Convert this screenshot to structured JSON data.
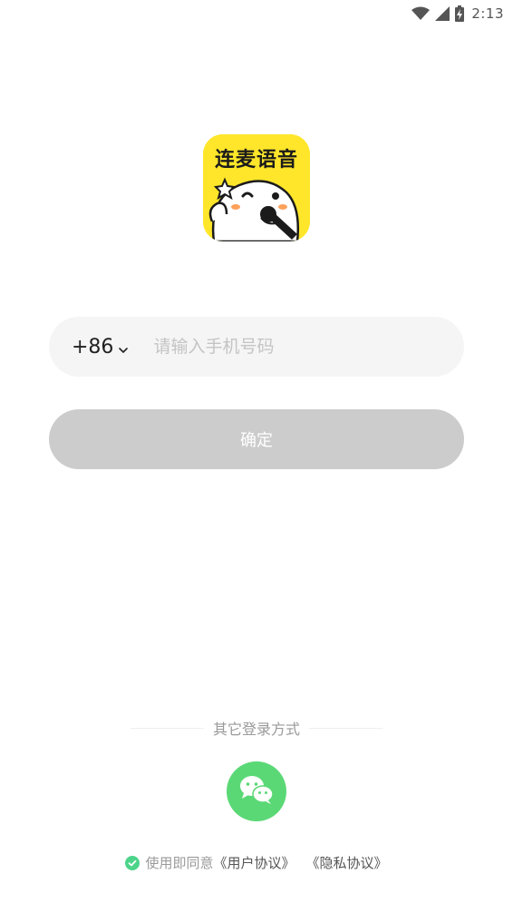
{
  "status_bar": {
    "time": "2:13",
    "icons": [
      "wifi-icon",
      "signal-icon",
      "battery-charging-icon"
    ]
  },
  "logo": {
    "text": "连麦语音",
    "icon": "mascot-with-microphone"
  },
  "phone": {
    "country_code": "+86",
    "placeholder": "请输入手机号码",
    "value": ""
  },
  "confirm": {
    "label": "确定"
  },
  "other_login": {
    "label": "其它登录方式",
    "wechat_icon": "wechat-icon"
  },
  "agreement": {
    "prefix": "使用即同意",
    "user_agreement": "《用户协议》",
    "privacy_policy": "《隐私协议》"
  },
  "colors": {
    "brand_yellow": "#ffe62a",
    "wechat_green": "#5bd876",
    "check_green": "#4cd48a",
    "button_disabled": "#cccccc",
    "input_bg": "#f5f5f5"
  }
}
